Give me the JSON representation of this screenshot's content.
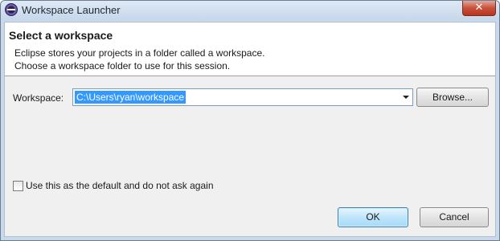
{
  "window": {
    "title": "Workspace Launcher",
    "app_icon": "eclipse-icon",
    "close_glyph": "✕"
  },
  "banner": {
    "title": "Select a workspace",
    "line1": "Eclipse stores your projects in a folder called a workspace.",
    "line2": "Choose a workspace folder to use for this session."
  },
  "workspace": {
    "label": "Workspace:",
    "value": "C:\\Users\\ryan\\workspace",
    "dropdown_icon": "chevron-down-icon",
    "browse_label": "Browse..."
  },
  "options": {
    "default_checkbox_label": "Use this as the default and do not ask again",
    "default_checked": false
  },
  "buttons": {
    "ok": "OK",
    "cancel": "Cancel"
  }
}
